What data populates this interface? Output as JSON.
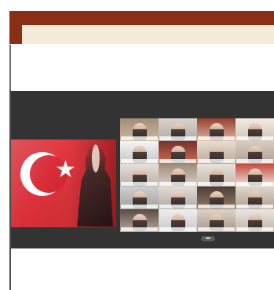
{
  "colors": {
    "banner": "#8b2e16",
    "banner_inner": "#f6ead9",
    "video_bg": "#333333",
    "flag_red": "#d51f2a"
  },
  "icons": {
    "flag_star": "★"
  },
  "participants": [
    {
      "name": ""
    },
    {
      "name": ""
    },
    {
      "name": ""
    },
    {
      "name": ""
    },
    {
      "name": ""
    },
    {
      "name": ""
    },
    {
      "name": ""
    },
    {
      "name": ""
    },
    {
      "name": ""
    },
    {
      "name": ""
    },
    {
      "name": ""
    },
    {
      "name": ""
    },
    {
      "name": ""
    },
    {
      "name": ""
    },
    {
      "name": ""
    },
    {
      "name": ""
    },
    {
      "name": ""
    },
    {
      "name": ""
    },
    {
      "name": ""
    },
    {
      "name": ""
    }
  ]
}
